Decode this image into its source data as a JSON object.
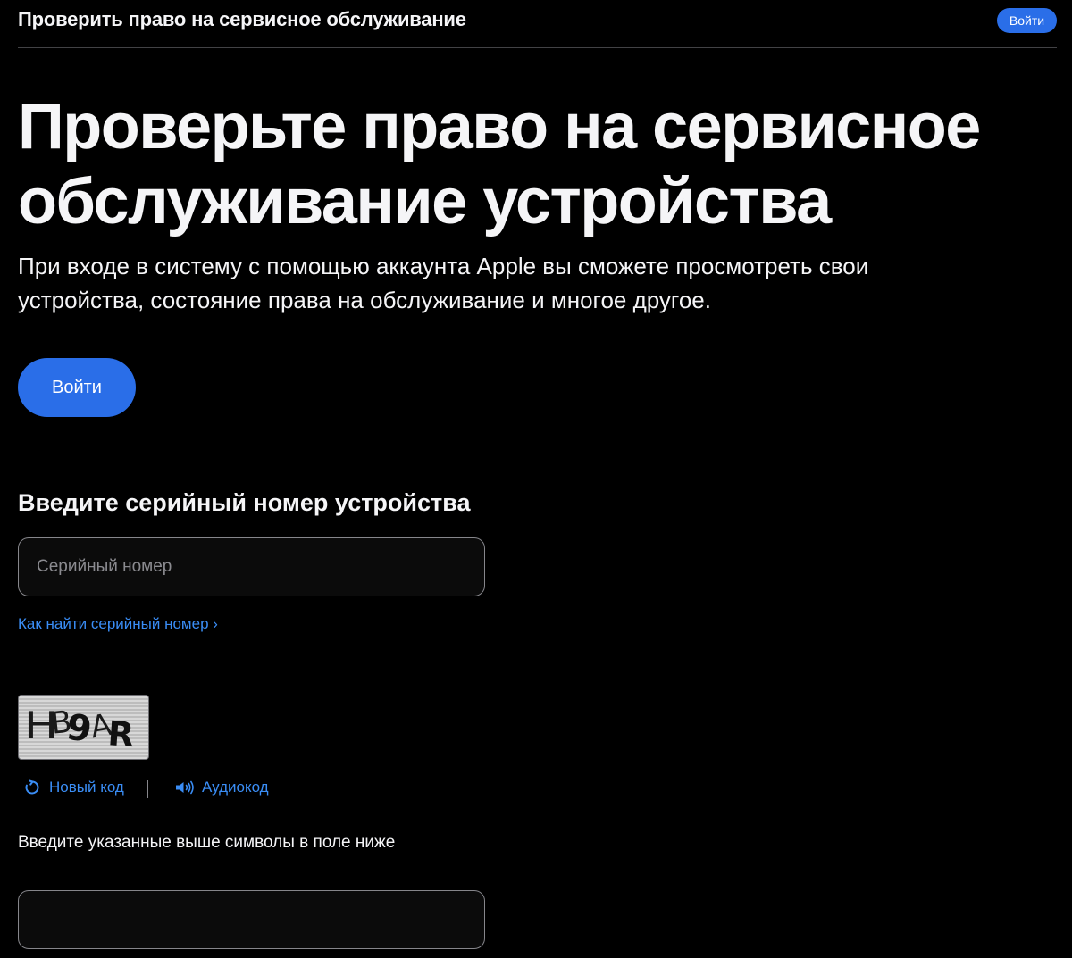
{
  "header": {
    "title": "Проверить право на сервисное обслуживание",
    "signin_label": "Войти"
  },
  "hero": {
    "title": "Проверьте право на сервисное обслуживание устройства",
    "subtitle": "При входе в систему с помощью аккаунта Apple вы сможете просмотреть свои устройства, состояние права на обслуживание и многое другое.",
    "signin_label": "Войти"
  },
  "serial": {
    "heading": "Введите серийный номер устройства",
    "placeholder": "Серийный номер",
    "value": "",
    "help_link": "Как найти серийный номер ›"
  },
  "captcha": {
    "code_text": "HB9AR",
    "new_code_label": "Новый код",
    "new_code_icon": "refresh-icon",
    "audio_code_label": "Аудиокод",
    "audio_code_icon": "speaker-icon",
    "instruction": "Введите указанные выше символы в поле ниже",
    "input_value": ""
  },
  "colors": {
    "background": "#000000",
    "text": "#f5f5f7",
    "accent": "#2a6ee8",
    "link": "#3a8df5",
    "border": "#86868b"
  }
}
